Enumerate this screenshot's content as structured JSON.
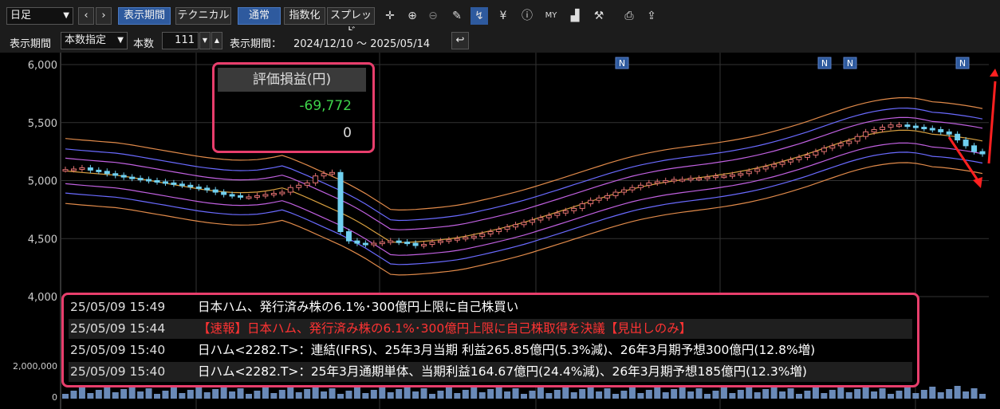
{
  "toolbar": {
    "period_select": "日足",
    "btn_display_period": "表示期間",
    "btn_technical": "テクニカル",
    "btn_normal": "通常",
    "btn_index": "指数化",
    "btn_spread": "スプレッド",
    "icons": [
      "arrow-left-icon",
      "arrow-right-icon",
      "crosshair-icon",
      "zoom-in-icon",
      "zoom-out-icon",
      "pencil-icon",
      "chart-check-icon",
      "yen-icon",
      "info-icon",
      "my-chart-icon",
      "area-chart-icon",
      "wrench-icon",
      "print-icon",
      "export-icon"
    ]
  },
  "row2": {
    "period_label": "表示期間",
    "period_mode": "本数指定",
    "count_label": "本数",
    "count_value": "111",
    "range_label": "表示期間：",
    "range_value": "2024/12/10 ～ 2025/05/14"
  },
  "pl_panel": {
    "header": "評価損益(円)",
    "value": "-69,772",
    "value2": "0"
  },
  "news": [
    {
      "time": "25/05/09 15:49",
      "text": "日本ハム、発行済み株の6.1%･300億円上限に自己株買い",
      "color": "#ffffff"
    },
    {
      "time": "25/05/09 15:44",
      "text": "【速報】日本ハム、発行済み株の6.1%･300億円上限に自己株取得を決議【見出しのみ】",
      "color": "#ff3333"
    },
    {
      "time": "25/05/09 15:40",
      "text": "日ハム<2282.T>：連結(IFRS)、25年3月当期 利益265.85億円(5.3%減)、26年3月期予想300億円(12.8%増)",
      "color": "#ffffff"
    },
    {
      "time": "25/05/09 15:40",
      "text": "日ハム<2282.T>：25年3月通期単体、当期利益164.67億円(24.4%減)、26年3月期予想185億円(12.3%増)",
      "color": "#ffffff"
    }
  ],
  "chart_data": {
    "type": "line",
    "y_ticks": [
      "6,000",
      "5,500",
      "5,000",
      "4,500",
      "4,000"
    ],
    "ylim": [
      4000,
      6000
    ],
    "volume_ticks": [
      "2,000,000",
      "0"
    ],
    "news_markers": [
      "N",
      "N",
      "N",
      "N"
    ],
    "bar_count": 111,
    "series": [
      {
        "name": "",
        "color": "#5fd3e8",
        "values": [
          5095,
          5100,
          5110,
          5090,
          5080,
          5060,
          5045,
          5030,
          5020,
          5010,
          5000,
          4990,
          4980,
          4970,
          4960,
          4945,
          4935,
          4920,
          4900,
          4880,
          4870,
          4860,
          4860,
          4870,
          4880,
          4890,
          4900,
          4940,
          4960,
          4980,
          5040,
          5060,
          5070,
          4560,
          4480,
          4460,
          4450,
          4460,
          4470,
          4480,
          4470,
          4460,
          4440,
          4450,
          4470,
          4480,
          4490,
          4500,
          4510,
          4520,
          4540,
          4560,
          4580,
          4600,
          4620,
          4640,
          4660,
          4680,
          4700,
          4720,
          4740,
          4760,
          4800,
          4830,
          4850,
          4870,
          4900,
          4920,
          4940,
          4960,
          4980,
          4990,
          5000,
          5010,
          5010,
          5020,
          5020,
          5030,
          5040,
          5040,
          5050,
          5060,
          5080,
          5100,
          5120,
          5140,
          5160,
          5180,
          5200,
          5220,
          5250,
          5280,
          5300,
          5320,
          5340,
          5380,
          5420,
          5440,
          5460,
          5480,
          5480,
          5470,
          5460,
          5450,
          5440,
          5420,
          5400,
          5350,
          5300,
          5250,
          5230
        ]
      }
    ]
  }
}
